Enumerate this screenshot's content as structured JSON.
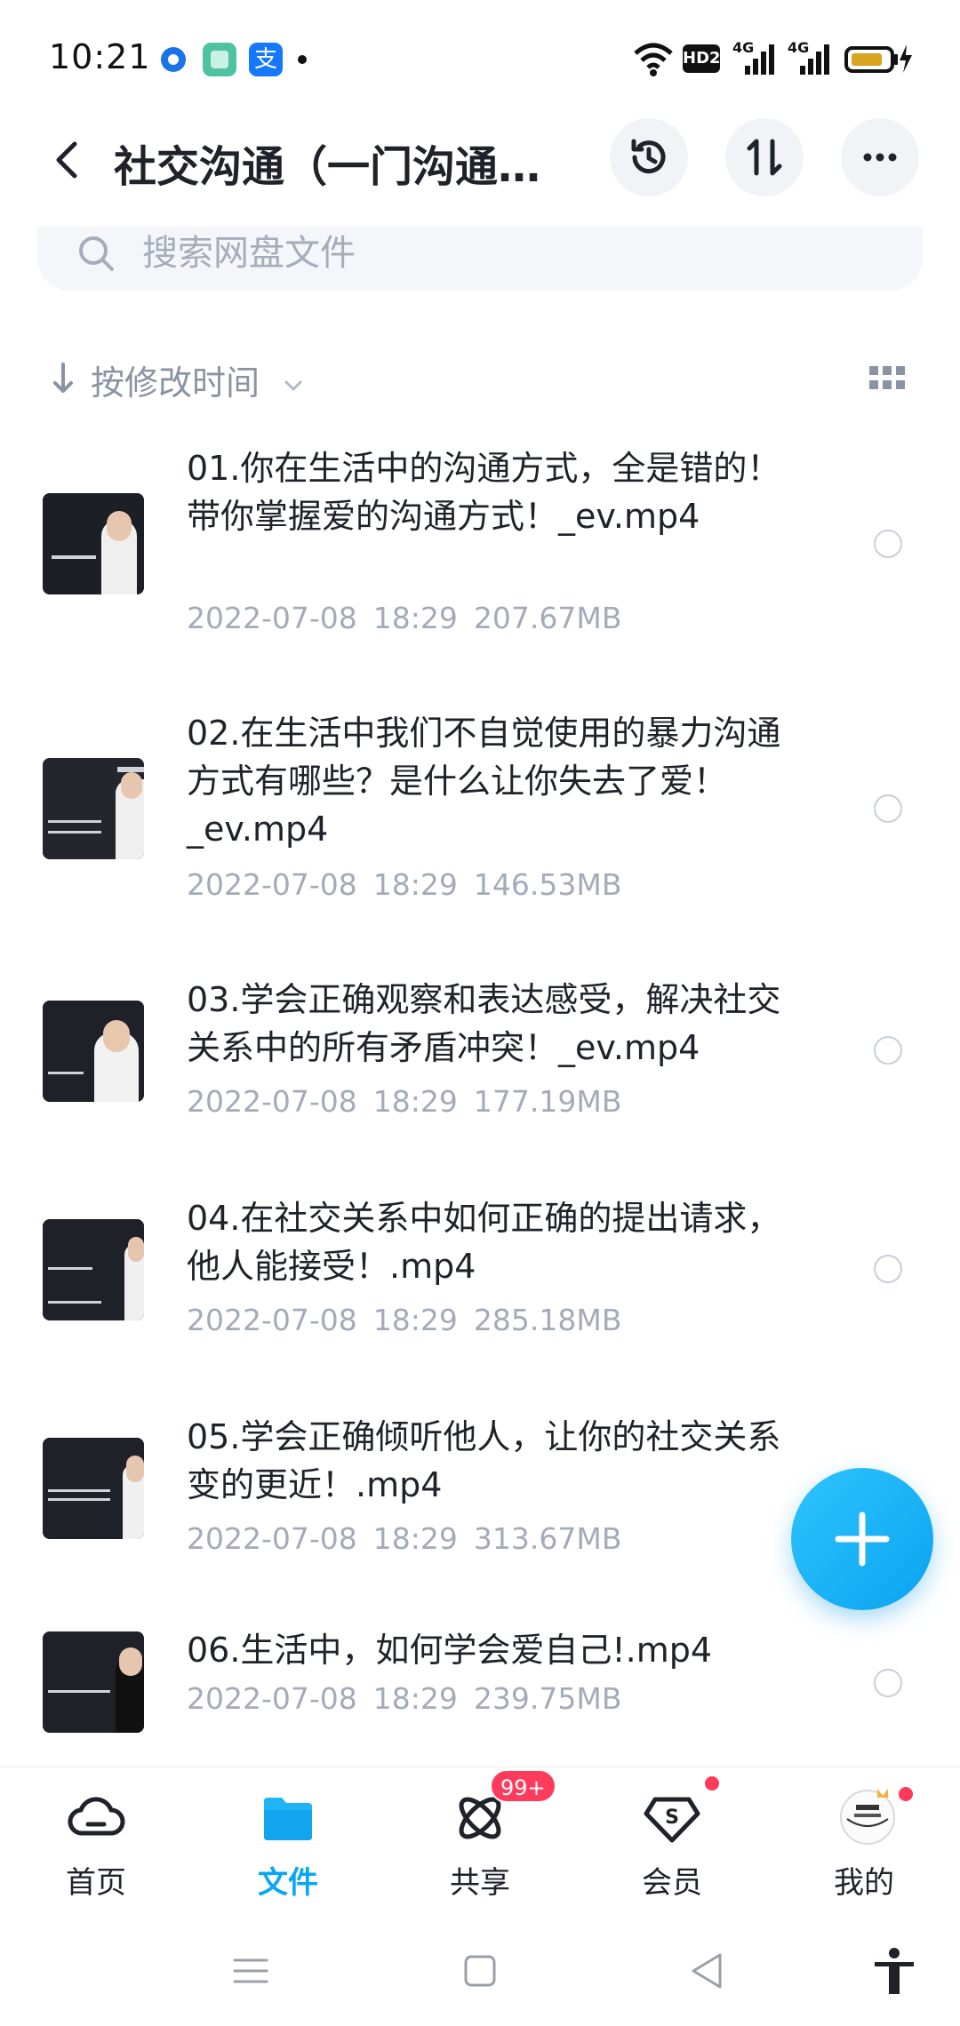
{
  "status_bar": {
    "time": "10:21",
    "apps": [
      {
        "icon": "baidu-app-icon",
        "color": "#1a73e8"
      },
      {
        "icon": "app-square-icon",
        "color": "#4fc3a1"
      },
      {
        "icon": "alipay-icon",
        "color": "#1677ff",
        "glyph": "支"
      }
    ],
    "hd_label": "HD2",
    "signal_label_1": "4G",
    "signal_label_2": "4G",
    "battery_color": "#d9a520"
  },
  "header": {
    "title": "社交沟通（一门沟通…",
    "buttons": [
      "history-icon",
      "sort-toggle-icon",
      "more-icon"
    ]
  },
  "search": {
    "placeholder": "搜索网盘文件"
  },
  "sort": {
    "label": "按修改时间"
  },
  "files": [
    {
      "name": "01.你在生活中的沟通方式，全是错的！ 带你掌握爱的沟通方式！_ev.mp4",
      "date": "2022-07-08",
      "time": "18:29",
      "size": "207.67MB"
    },
    {
      "name": "02.在生活中我们不自觉使用的暴力沟通方式有哪些？是什么让你失去了爱！_ev.mp4",
      "date": "2022-07-08",
      "time": "18:29",
      "size": "146.53MB"
    },
    {
      "name": "03.学会正确观察和表达感受，解决社交关系中的所有矛盾冲突！_ev.mp4",
      "date": "2022-07-08",
      "time": "18:29",
      "size": "177.19MB"
    },
    {
      "name": "04.在社交关系中如何正确的提出请求，他人能接受！.mp4",
      "date": "2022-07-08",
      "time": "18:29",
      "size": "285.18MB"
    },
    {
      "name": "05.学会正确倾听他人，让你的社交关系变的更近！.mp4",
      "date": "2022-07-08",
      "time": "18:29",
      "size": "313.67MB"
    },
    {
      "name": "06.生活中，如何学会爱自己!.mp4",
      "date": "2022-07-08",
      "time": "18:29",
      "size": "239.75MB"
    }
  ],
  "bottom_nav": [
    {
      "label": "首页",
      "icon": "cloud-icon"
    },
    {
      "label": "文件",
      "icon": "folder-icon",
      "active": true
    },
    {
      "label": "共享",
      "icon": "share-atom-icon",
      "badge": "99+"
    },
    {
      "label": "会员",
      "icon": "vip-diamond-icon"
    },
    {
      "label": "我的",
      "icon": "avatar-icon"
    }
  ],
  "colors": {
    "accent": "#09a6f3",
    "badge": "#ff3b5c"
  }
}
